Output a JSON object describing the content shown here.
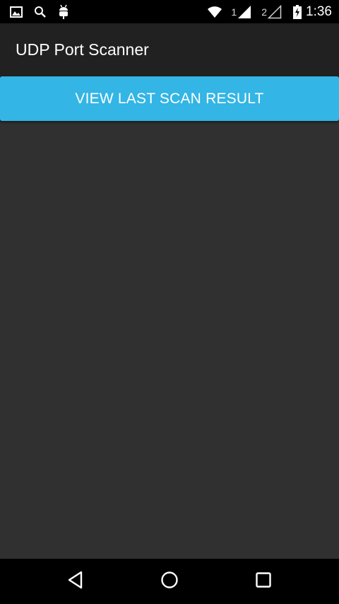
{
  "status_bar": {
    "icons": {
      "left": [
        "gallery-icon",
        "search-icon",
        "android-debug-icon"
      ],
      "right": [
        "wifi-icon",
        "signal-sim1-icon",
        "signal-sim2-icon",
        "battery-charging-icon"
      ]
    },
    "sim1_label": "1",
    "sim2_label": "2",
    "time": "1:36"
  },
  "action_bar": {
    "title": "UDP Port Scanner"
  },
  "main": {
    "view_last_scan_label": "VIEW LAST SCAN RESULT"
  },
  "nav_bar": {
    "icons": [
      "back-icon",
      "home-icon",
      "recents-icon"
    ]
  },
  "colors": {
    "status_bar": "#000000",
    "action_bar": "#212121",
    "background": "#303030",
    "accent": "#33b5e5",
    "nav_bar": "#000000"
  }
}
